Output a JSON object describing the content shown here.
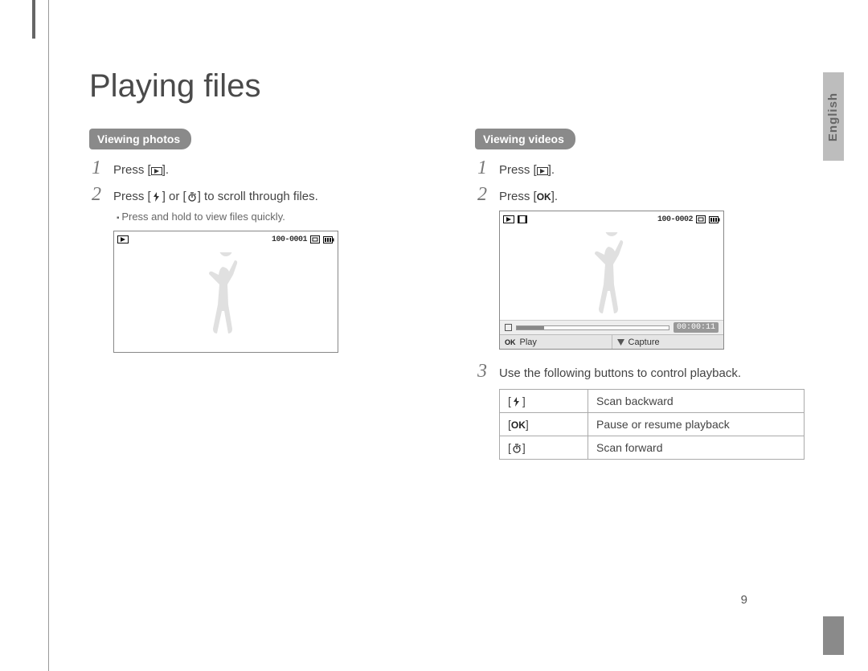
{
  "title": "Playing files",
  "language_tab": "English",
  "page_number": "9",
  "col_photos": {
    "heading": "Viewing photos",
    "step1": "Press [",
    "step1_end": "].",
    "step2_a": "Press [",
    "step2_b": "] or [",
    "step2_c": "] to scroll through files.",
    "sub": "Press and hold to view files quickly.",
    "file_counter": "100-0001"
  },
  "col_videos": {
    "heading": "Viewing videos",
    "step1": "Press [",
    "step1_end": "].",
    "step2_a": "Press [",
    "step2_ok": "OK",
    "step2_b": "].",
    "file_counter": "100-0002",
    "timecode": "00:00:11",
    "bottom_ok": "OK",
    "bottom_play": "Play",
    "bottom_capture": "Capture",
    "step3": "Use the following buttons to control playback.",
    "table": {
      "r1": "Scan backward",
      "r2_key": "OK",
      "r2": "Pause or resume playback",
      "r3": "Scan forward"
    }
  }
}
